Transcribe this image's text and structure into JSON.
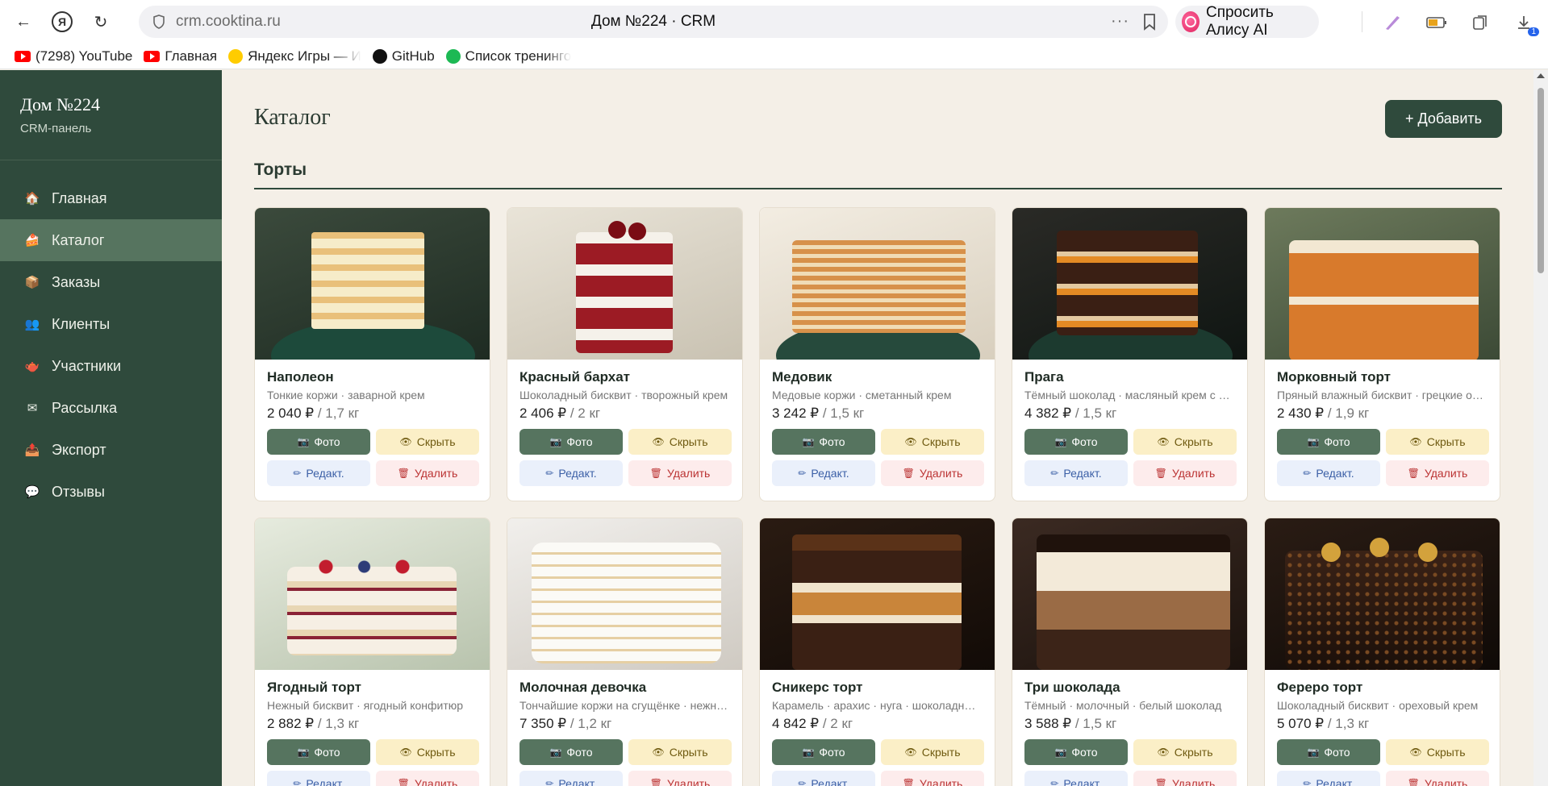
{
  "browser": {
    "url": "crm.cooktina.ru",
    "title": "Дом №224 · CRM",
    "alice_label": "Спросить Алису AI",
    "download_badge": "1",
    "bookmarks": [
      {
        "label": "(7298) YouTube",
        "icon": "youtube-icon"
      },
      {
        "label": "Главная",
        "icon": "youtube-icon"
      },
      {
        "label": "Яндекс Игры — И",
        "icon": "yandex-games-icon"
      },
      {
        "label": "GitHub",
        "icon": "github-icon"
      },
      {
        "label": "Список тренинго",
        "icon": "list-icon"
      }
    ]
  },
  "sidebar": {
    "title": "Дом №224",
    "subtitle": "CRM-панель",
    "items": [
      {
        "label": "Главная",
        "icon": "🏠"
      },
      {
        "label": "Каталог",
        "icon": "🍰"
      },
      {
        "label": "Заказы",
        "icon": "📦"
      },
      {
        "label": "Клиенты",
        "icon": "👥"
      },
      {
        "label": "Участники",
        "icon": "🫖"
      },
      {
        "label": "Рассылка",
        "icon": "✉"
      },
      {
        "label": "Экспорт",
        "icon": "📤"
      },
      {
        "label": "Отзывы",
        "icon": "💬"
      }
    ]
  },
  "main": {
    "title": "Каталог",
    "add_button": "+ Добавить",
    "section": "Торты",
    "buttons": {
      "photo": "Фото",
      "hide": "Скрыть",
      "edit": "Редакт.",
      "delete": "Удалить"
    },
    "products": [
      {
        "name": "Наполеон",
        "desc": "Тонкие коржи · заварной крем",
        "price": "2 040 ₽",
        "weight": " / 1,7 кг"
      },
      {
        "name": "Красный бархат",
        "desc": "Шоколадный бисквит · творожный крем",
        "price": "2 406 ₽",
        "weight": " / 2 кг"
      },
      {
        "name": "Медовик",
        "desc": "Медовые коржи · сметанный крем",
        "price": "3 242 ₽",
        "weight": " / 1,5 кг"
      },
      {
        "name": "Прага",
        "desc": "Тёмный шоколад · масляный крем с абрикосом",
        "price": "4 382 ₽",
        "weight": " / 1,5 кг"
      },
      {
        "name": "Морковный торт",
        "desc": "Пряный влажный бисквит · грецкие орехи",
        "price": "2 430 ₽",
        "weight": " / 1,9 кг"
      },
      {
        "name": "Ягодный торт",
        "desc": "Нежный бисквит · ягодный конфитюр",
        "price": "2 882 ₽",
        "weight": " / 1,3 кг"
      },
      {
        "name": "Молочная девочка",
        "desc": "Тончайшие коржи на сгущёнке · нежный крем",
        "price": "7 350 ₽",
        "weight": " / 1,2 кг"
      },
      {
        "name": "Сникерс торт",
        "desc": "Карамель · арахис · нуга · шоколадный бисквит",
        "price": "4 842 ₽",
        "weight": " / 2 кг"
      },
      {
        "name": "Три шоколада",
        "desc": "Тёмный · молочный · белый шоколад",
        "price": "3 588 ₽",
        "weight": " / 1,5 кг"
      },
      {
        "name": "Фереро торт",
        "desc": "Шоколадный бисквит · ореховый крем",
        "price": "5 070 ₽",
        "weight": " / 1,3 кг"
      }
    ]
  },
  "colors": {
    "sidebar": "#2f4a3c",
    "active": "#56745f",
    "background": "#f4efe7"
  }
}
